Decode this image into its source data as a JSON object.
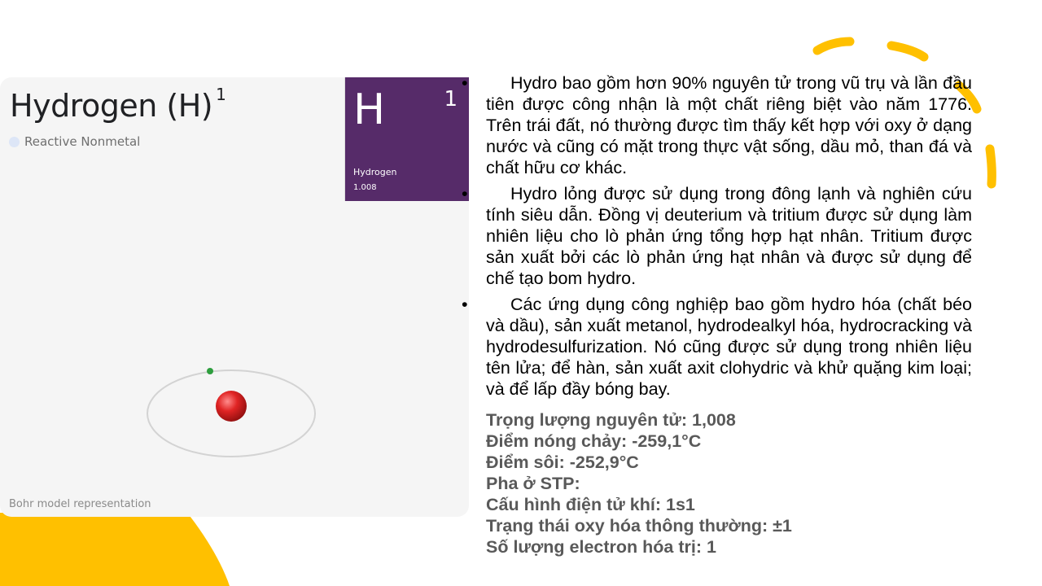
{
  "element": {
    "name": "Hydrogen (H)",
    "atomic_number": "1",
    "category": "Reactive Nonmetal",
    "tile": {
      "symbol": "H",
      "number": "1",
      "name": "Hydrogen",
      "mass": "1.008"
    },
    "bohr_caption": "Bohr model representation"
  },
  "bullets": [
    "Hydro bao gồm hơn 90% nguyên tử trong vũ trụ và lần đầu tiên được công nhận là một chất riêng biệt vào năm 1776. Trên trái đất, nó thường được tìm thấy kết hợp với oxy ở dạng nước và cũng có mặt trong thực vật sống, dầu mỏ, than đá và chất hữu cơ khác.",
    "Hydro lỏng được sử dụng trong đông lạnh và nghiên cứu tính siêu dẫn. Đồng vị deuterium và tritium được sử dụng làm nhiên liệu cho lò phản ứng tổng hợp hạt nhân. Tritium được sản xuất bởi các lò phản ứng hạt nhân và được sử dụng để chế tạo bom hydro.",
    "Các ứng dụng công nghiệp bao gồm hydro hóa (chất béo và dầu), sản xuất metanol, hydrodealkyl hóa, hydrocracking và hydrodesulfurization. Nó cũng được sử dụng trong nhiên liệu tên lửa; để hàn, sản xuất axit clohydric và khử quặng kim loại; và để lấp đầy bóng bay."
  ],
  "bullet_marker": "•",
  "properties": [
    "Trọng lượng nguyên tử: 1,008",
    "Điểm nóng chảy: -259,1°C",
    "Điểm sôi: -252,9°C",
    "Pha ở STP:",
    "Cấu hình điện tử khí: 1s1",
    "Trạng thái oxy hóa thông thường: ±1",
    "Số lượng electron hóa trị: 1"
  ],
  "colors": {
    "accent_yellow": "#ffc000",
    "tile_purple": "#562b69",
    "nucleus_red": "#d01f1f",
    "electron_green": "#2e9e3e"
  }
}
